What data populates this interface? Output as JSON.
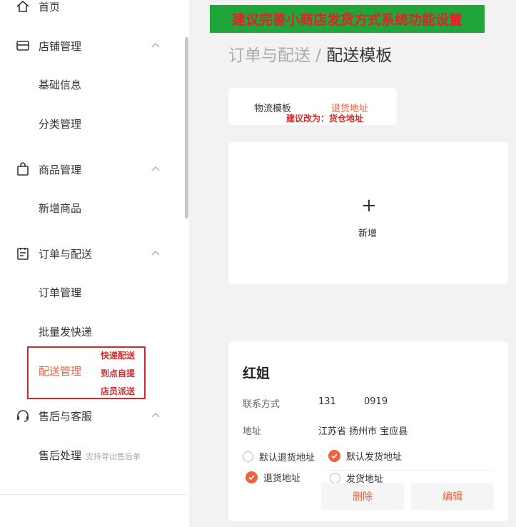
{
  "sidebar": {
    "home": {
      "label": "首页",
      "icon": "home-icon"
    },
    "store": {
      "label": "店铺管理",
      "icon": "store-icon",
      "children": [
        "基础信息",
        "分类管理"
      ]
    },
    "goods": {
      "label": "商品管理",
      "icon": "shopping-bag-icon",
      "children": [
        "新增商品"
      ]
    },
    "orders": {
      "label": "订单与配送",
      "icon": "clipboard-icon",
      "children": [
        "订单管理",
        "批量发快递",
        "配送管理"
      ]
    },
    "after_sales": {
      "label": "售后与客服",
      "icon": "headset-icon",
      "children": [
        "售后处理"
      ],
      "children_hint": "支持导出售后单"
    },
    "active_label": "配送管理",
    "red_notes": [
      "快递配送",
      "到点自提",
      "店员派送"
    ]
  },
  "banner": {
    "text": "建议完善小商店发货方式系统功能设置",
    "bg_color": "#1fa53a",
    "text_color": "#e5202a"
  },
  "breadcrumb": {
    "parent": "订单与配送",
    "separator": " / ",
    "current": "配送模板"
  },
  "tabs": {
    "items": [
      "物流模板",
      "退货地址"
    ],
    "active": "退货地址",
    "suggestion": "建议改为：货仓地址"
  },
  "add_card": {
    "plus": "+",
    "label": "新增"
  },
  "address": {
    "name": "红姐",
    "contact_label": "联系方式",
    "contact_value_a": "131",
    "contact_value_b": "0919",
    "address_label": "地址",
    "address_value": "江苏省 扬州市 宝应县",
    "options": [
      {
        "label": "默认退货地址",
        "checked": false
      },
      {
        "label": "默认发货地址",
        "checked": true
      },
      {
        "label": "退货地址",
        "checked": true
      },
      {
        "label": "发货地址",
        "checked": false
      }
    ],
    "delete_label": "删除",
    "edit_label": "编辑"
  },
  "colors": {
    "accent": "#e8603c",
    "check": "#f0613d",
    "annotation": "#d42a2a"
  }
}
